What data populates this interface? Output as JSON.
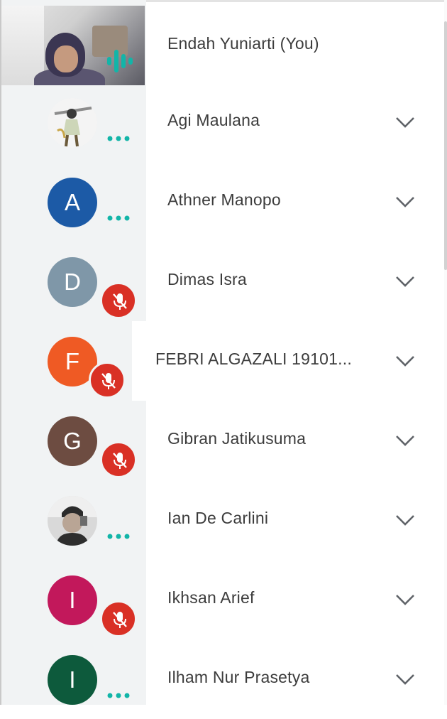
{
  "participants": [
    {
      "name": "Endah Yuniarti (You)",
      "avatar_type": "video",
      "status": "speaking",
      "has_menu": false
    },
    {
      "name": "Agi Maulana",
      "avatar_type": "photo",
      "status": "audio-dots",
      "has_menu": true
    },
    {
      "name": "Athner Manopo",
      "avatar_type": "initial",
      "initial": "A",
      "color": "#1c5aa6",
      "status": "audio-dots",
      "has_menu": true
    },
    {
      "name": "Dimas Isra",
      "avatar_type": "initial",
      "initial": "D",
      "color": "#7f97a8",
      "status": "muted",
      "has_menu": true
    },
    {
      "name": "FEBRI ALGAZALI 19101...",
      "avatar_type": "initial",
      "initial": "F",
      "color": "#ef5a24",
      "status": "muted",
      "has_menu": true
    },
    {
      "name": "Gibran Jatikusuma",
      "avatar_type": "initial",
      "initial": "G",
      "color": "#6d4c41",
      "status": "muted",
      "has_menu": true
    },
    {
      "name": "Ian De Carlini",
      "avatar_type": "photo",
      "status": "audio-dots",
      "has_menu": true
    },
    {
      "name": "Ikhsan Arief",
      "avatar_type": "initial",
      "initial": "I",
      "color": "#c2185b",
      "status": "muted",
      "has_menu": true
    },
    {
      "name": "Ilham Nur Prasetya",
      "avatar_type": "initial",
      "initial": "I",
      "color": "#0d5a3c",
      "status": "audio-dots",
      "has_menu": true
    }
  ],
  "colors": {
    "mute_badge": "#d93025",
    "audio_dots": "#12b5a8",
    "chevron": "#5f6368",
    "name_text": "#3c3c3c"
  },
  "icons": {
    "mute": "mic-off-icon",
    "menu": "chevron-down-icon",
    "audio": "audio-dots-icon",
    "speaking": "audio-wave-icon"
  }
}
